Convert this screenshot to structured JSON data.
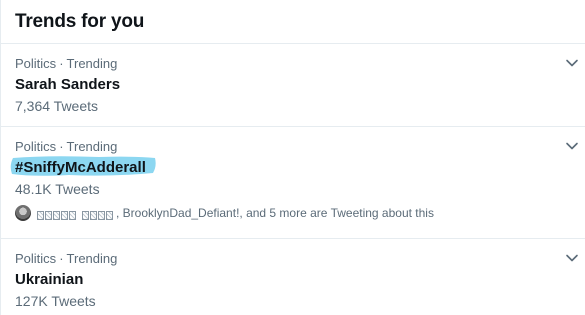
{
  "header": {
    "title": "Trends for you"
  },
  "trends": [
    {
      "category": "Politics",
      "separator": "·",
      "status": "Trending",
      "name": "Sarah Sanders",
      "count": "7,364 Tweets"
    },
    {
      "category": "Politics",
      "separator": "·",
      "status": "Trending",
      "name": "#SniffyMcAdderall",
      "count": "48.1K Tweets",
      "highlight_color": "#7fd3f0",
      "social_context": ", BrooklynDad_Defiant!, and 5 more are Tweeting about this"
    },
    {
      "category": "Politics",
      "separator": "·",
      "status": "Trending",
      "name": "Ukrainian",
      "count": "127K Tweets"
    }
  ],
  "icons": {
    "more": "chevron-down-icon",
    "avatar": "avatar"
  },
  "colors": {
    "text_primary": "#0f1419",
    "text_secondary": "#5b6b78",
    "divider": "#e6ecf0",
    "highlight": "#7fd3f0"
  }
}
